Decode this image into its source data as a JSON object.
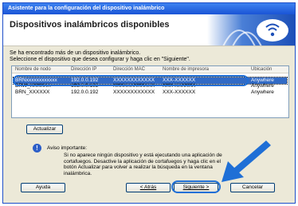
{
  "window": {
    "title": "Asistente para la configuración del dispositivo inalámbrico"
  },
  "banner": {
    "title": "Dispositivos inalámbricos disponibles"
  },
  "intro": {
    "line1": "Se ha encontrado más de un dispositivo inalámbrico.",
    "line2": "Seleccione el dispositivo que desea configurar y haga clic en \"Siguiente\"."
  },
  "list": {
    "columns": [
      "Nombre de nodo",
      "Dirección IP",
      "Dirección MAC",
      "Nombre de impresora",
      "Ubicación"
    ],
    "rows": [
      [
        "BRNxxxxxxxxxxxx",
        "192.0.0.192",
        "XXXXXXXXXXXX",
        "XXX-XXXXXX",
        "Anywhere"
      ],
      [
        "BRW_XXXXXX",
        "192.0.0.192",
        "XXXXXXXXXXXX",
        "XXX-XXXXXX",
        "Anywhere"
      ],
      [
        "BRN_XXXXXX",
        "192.0.0.192",
        "XXXXXXXXXXXX",
        "XXX-XXXXXX",
        "Anywhere"
      ]
    ]
  },
  "buttons": {
    "refresh": "Actualizar",
    "help": "Ayuda",
    "back": "< Atrás",
    "next": "Siguiente >",
    "cancel": "Cancelar"
  },
  "notice": {
    "title": "Aviso importante:",
    "line1": "Si no aparece ningún dispositivo y está ejecutando una aplicación de",
    "line2": "cortafuegos. Desactive la aplicación de cortafuegos y haga clic en el",
    "line3": "botón Actualizar para volver a realizar la búsqueda en la ventana",
    "line4": "inalámbrica."
  },
  "colors": {
    "accent": "#1f6fd6",
    "titlebar": "#1a54d6",
    "selection": "#316ac5"
  }
}
